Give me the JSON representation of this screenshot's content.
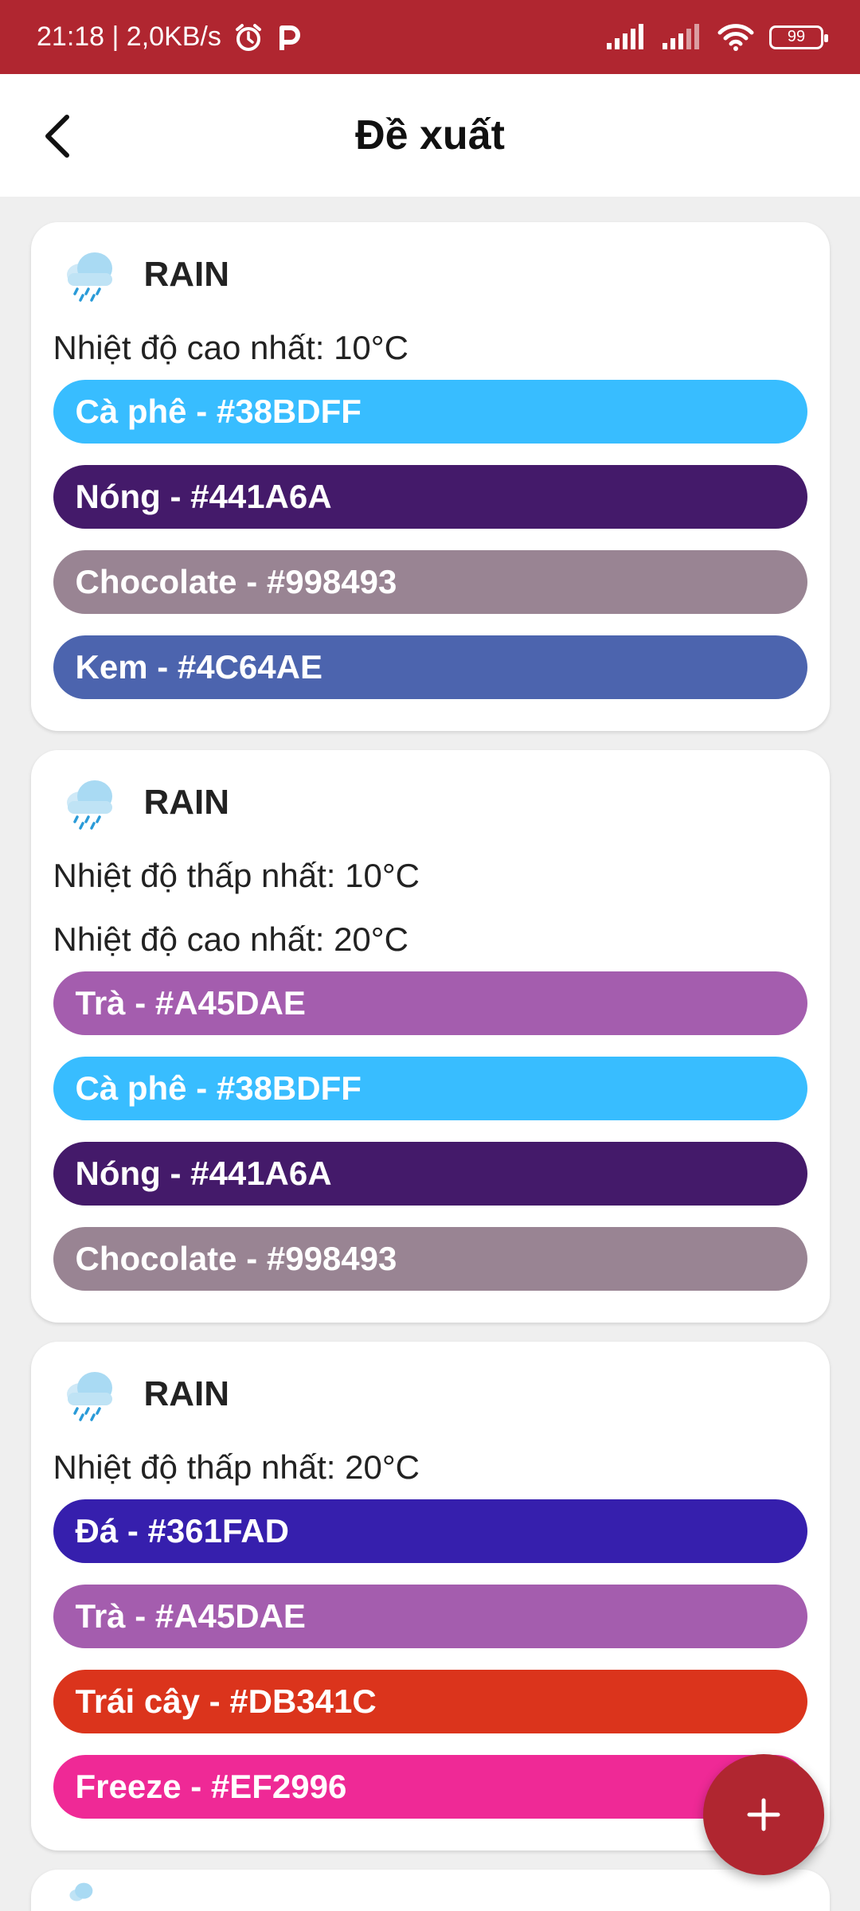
{
  "status_bar": {
    "time": "21:18 | 2,0KB/s",
    "battery": "99"
  },
  "header": {
    "title": "Đề xuất"
  },
  "cards": [
    {
      "weather": "RAIN",
      "temps": [
        "Nhiệt độ cao nhất: 10°C"
      ],
      "items": [
        {
          "label": "Cà phê - #38BDFF",
          "color": "#38BDFF"
        },
        {
          "label": "Nóng - #441A6A",
          "color": "#441A6A"
        },
        {
          "label": "Chocolate - #998493",
          "color": "#998493"
        },
        {
          "label": "Kem - #4C64AE",
          "color": "#4C64AE"
        }
      ]
    },
    {
      "weather": "RAIN",
      "temps": [
        "Nhiệt độ thấp nhất: 10°C",
        "Nhiệt độ cao nhất: 20°C"
      ],
      "items": [
        {
          "label": "Trà - #A45DAE",
          "color": "#A45DAE"
        },
        {
          "label": "Cà phê - #38BDFF",
          "color": "#38BDFF"
        },
        {
          "label": "Nóng - #441A6A",
          "color": "#441A6A"
        },
        {
          "label": "Chocolate - #998493",
          "color": "#998493"
        }
      ]
    },
    {
      "weather": "RAIN",
      "temps": [
        "Nhiệt độ thấp nhất: 20°C"
      ],
      "items": [
        {
          "label": "Đá - #361FAD",
          "color": "#361FAD"
        },
        {
          "label": "Trà - #A45DAE",
          "color": "#A45DAE"
        },
        {
          "label": "Trái cây - #DB341C",
          "color": "#DB341C"
        },
        {
          "label": "Freeze - #EF2996",
          "color": "#EF2996"
        }
      ]
    }
  ],
  "icons": {
    "back": "arrow-back-icon",
    "weather": "rain-cloud-icon",
    "fab": "plus-icon"
  },
  "colors": {
    "accent": "#B02630"
  }
}
